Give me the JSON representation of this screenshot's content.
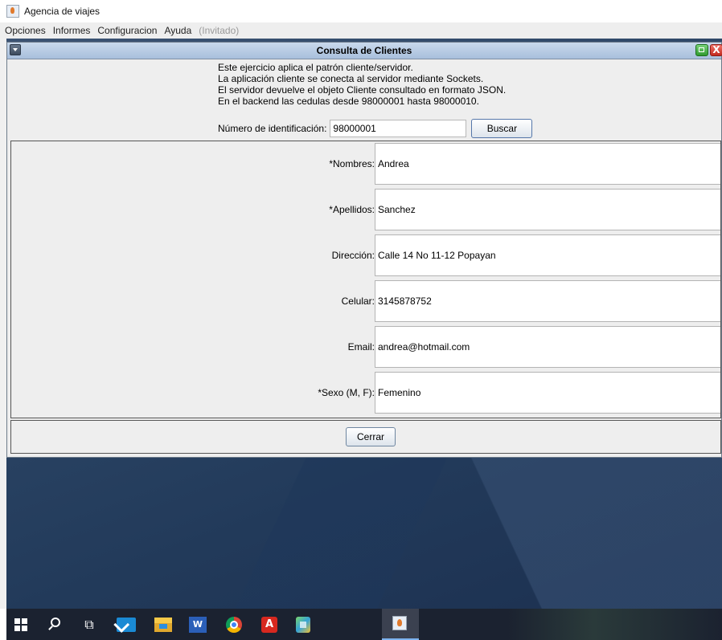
{
  "app": {
    "title": "Agencia de viajes",
    "menu": [
      "Opciones",
      "Informes",
      "Configuracion",
      "Ayuda",
      "(Invitado)"
    ]
  },
  "window": {
    "title": "Consulta de Clientes",
    "close_glyph": "X"
  },
  "info": {
    "lines": [
      "Este ejercicio aplica el patrón cliente/servidor.",
      "La aplicación cliente se conecta al servidor mediante Sockets.",
      "El servidor devuelve el objeto Cliente consultado en formato JSON.",
      "En el backend las cedulas desde 98000001 hasta 98000010."
    ]
  },
  "search": {
    "label": "Número de identificación:",
    "value": "98000001",
    "button": "Buscar"
  },
  "form": {
    "fields": [
      {
        "label": "*Nombres:",
        "value": "Andrea"
      },
      {
        "label": "*Apellidos:",
        "value": "Sanchez"
      },
      {
        "label": "Dirección:",
        "value": "Calle 14 No 11-12 Popayan"
      },
      {
        "label": "Celular:",
        "value": "3145878752"
      },
      {
        "label": "Email:",
        "value": "andrea@hotmail.com"
      },
      {
        "label": "*Sexo (M, F):",
        "value": "Femenino"
      }
    ]
  },
  "footer": {
    "close_button": "Cerrar"
  },
  "taskbar": {
    "task_view_glyph": "⧉",
    "word_letter": "W",
    "pdf_letter": "A"
  }
}
